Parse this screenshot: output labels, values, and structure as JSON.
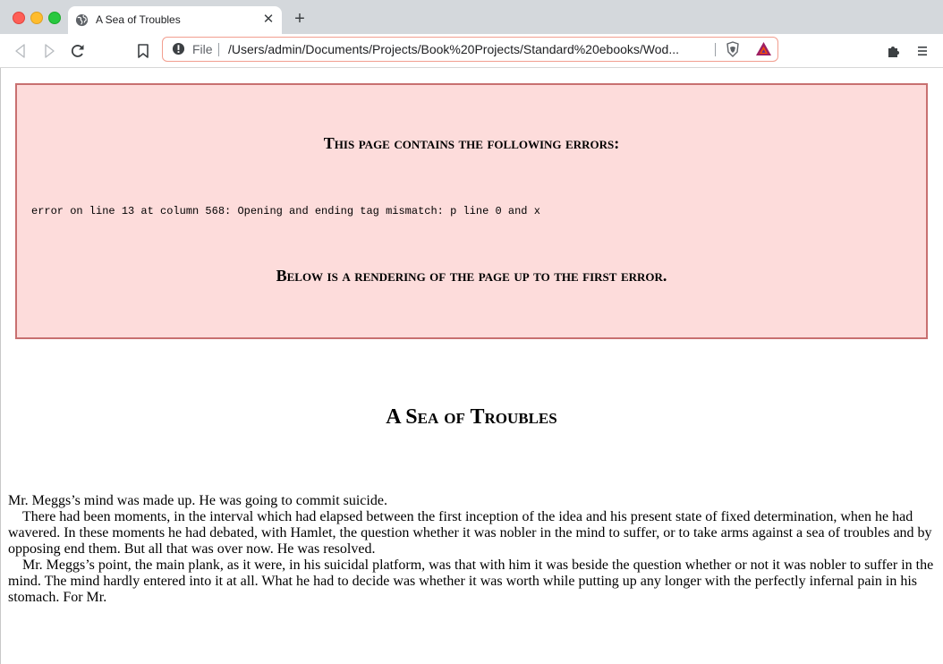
{
  "window": {
    "tab": {
      "title": "A Sea of Troubles"
    },
    "new_tab_label": "+",
    "tab_close_label": "✕"
  },
  "toolbar": {
    "omnibox": {
      "scheme_label": "File",
      "url": "/Users/admin/Documents/Projects/Book%20Projects/Standard%20ebooks/Wod..."
    }
  },
  "error_box": {
    "heading": "This page contains the following errors:",
    "message": "error on line 13 at column 568: Opening and ending tag mismatch: p line 0 and x",
    "footer": "Below is a rendering of the page up to the first error."
  },
  "document": {
    "title": "A Sea of Troubles",
    "paragraphs": [
      "Mr. Meggs’s mind was made up. He was going to commit suicide.",
      "There had been moments, in the interval which had elapsed between the first inception of the idea and his present state of fixed determination, when he had wavered. In these moments he had debated, with Hamlet, the question whether it was nobler in the mind to suffer, or to take arms against a sea of troubles and by opposing end them. But all that was over now. He was resolved.",
      "Mr. Meggs’s point, the main plank, as it were, in his suicidal platform, was that with him it was beside the question whether or not it was nobler to suffer in the mind. The mind hardly entered into it at all. What he had to decide was whether it was worth while putting up any longer with the perfectly infernal pain in his stomach. For Mr."
    ]
  },
  "colors": {
    "error_background": "#fddcdb",
    "error_border": "#c87070",
    "omnibox_border": "#f29e8f",
    "tabbar_background": "#d4d8dc"
  },
  "icons": {
    "tab_favicon": "globe-icon",
    "back": "back-arrow-icon",
    "forward": "forward-arrow-icon",
    "reload": "reload-icon",
    "bookmark": "bookmark-icon",
    "security": "warning-circle-icon",
    "brave_shields": "lion-shield-icon",
    "brave_rewards": "bat-triangle-icon",
    "extensions": "puzzle-icon",
    "menu": "hamburger-menu-icon"
  }
}
